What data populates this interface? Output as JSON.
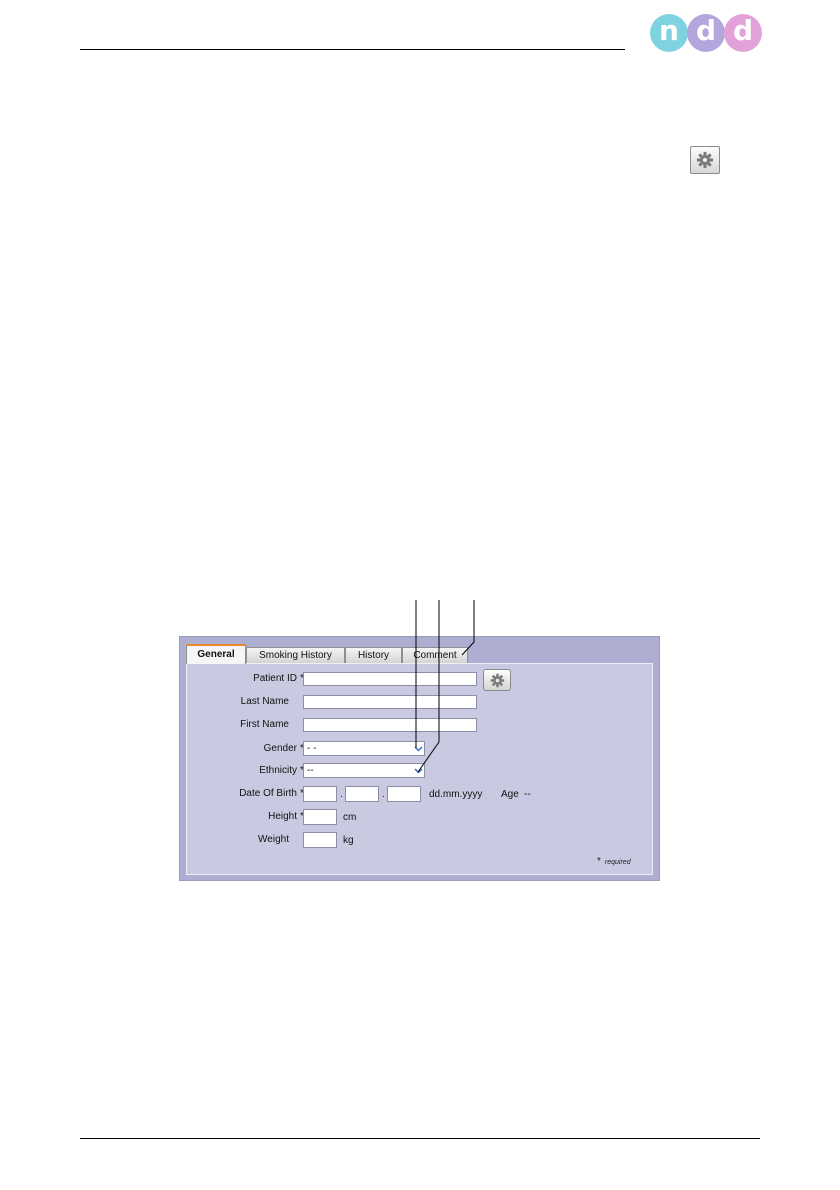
{
  "logo": {
    "letters": [
      "n",
      "d",
      "d"
    ],
    "colors": [
      "#7fd3e0",
      "#b2a6dc",
      "#e2a2d9"
    ]
  },
  "page_toolbar": {
    "icon": "gear-icon"
  },
  "tabs": [
    {
      "label": "General",
      "active": true
    },
    {
      "label": "Smoking History",
      "active": false
    },
    {
      "label": "History",
      "active": false
    },
    {
      "label": "Comment",
      "active": false
    }
  ],
  "form": {
    "patient_id": {
      "label": "Patient ID",
      "required": "*",
      "value": ""
    },
    "last_name": {
      "label": "Last Name",
      "value": ""
    },
    "first_name": {
      "label": "First Name",
      "value": ""
    },
    "gender": {
      "label": "Gender",
      "required": "*",
      "selected": "- -"
    },
    "ethnicity": {
      "label": "Ethnicity",
      "required": "*",
      "selected": "--"
    },
    "date_of_birth": {
      "label": "Date Of Birth",
      "required": "*",
      "separator": ".",
      "format": "dd.mm.yyyy",
      "age_label": "Age",
      "age_value": "--"
    },
    "height": {
      "label": "Height",
      "required": "*",
      "unit": "cm"
    },
    "weight": {
      "label": "Weight",
      "unit": "kg"
    },
    "required_note": {
      "star": "*",
      "text": "required"
    }
  },
  "colors": {
    "window_bg": "#aeaed2",
    "panel_bg": "#c9c9e1",
    "active_tab_accent": "#e88a2a"
  }
}
